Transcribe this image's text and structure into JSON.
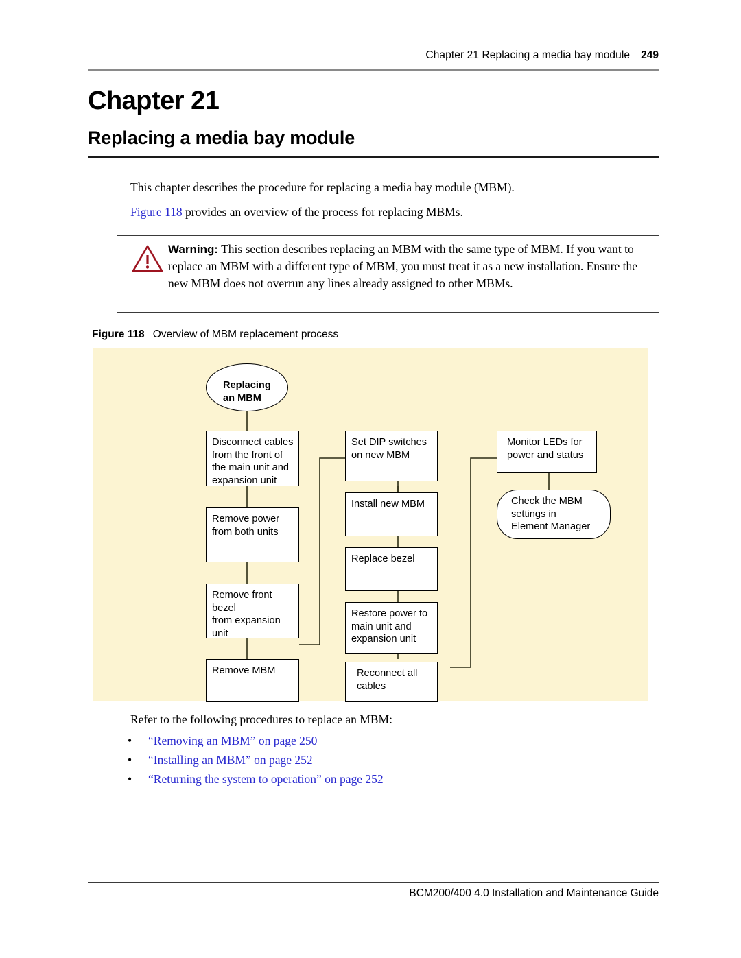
{
  "header": {
    "title": "Chapter 21  Replacing a media bay module",
    "page_number": "249"
  },
  "chapter": {
    "number_label": "Chapter 21",
    "title": "Replacing a media bay module"
  },
  "intro": {
    "paragraph_1": "This chapter describes the procedure for replacing a media bay module (MBM).",
    "xref_label": "Figure 118",
    "paragraph_2_rest": " provides an overview of the process for replacing MBMs."
  },
  "warning": {
    "icon_name": "warning-triangle-icon",
    "label": "Warning:",
    "text": " This section describes replacing an MBM with the same type of MBM. If you want to replace an MBM with a different type of MBM, you must treat it as a new installation. Ensure the new MBM does not overrun any lines already assigned to other MBMs.",
    "accent_color": "#9e1420"
  },
  "figure": {
    "label": "Figure 118",
    "caption": "Overview of MBM replacement process",
    "background_color": "#fcf4d2",
    "nodes": {
      "start": "Replacing\nan MBM",
      "col1_1": "Disconnect cables\nfrom the front of\nthe main unit and\nexpansion unit",
      "col1_2": "Remove power\nfrom both units",
      "col1_3": "Remove front bezel\nfrom expansion unit",
      "col1_4": "Remove MBM",
      "col2_1": "Set DIP switches\non new MBM",
      "col2_2": "Install new MBM",
      "col2_3": "Replace bezel",
      "col2_4": "Restore power to\nmain unit and\nexpansion unit",
      "col2_5": "Reconnect all\ncables",
      "col3_1": "Monitor LEDs for\npower and status",
      "col3_2": "Check the MBM\nsettings in\nElement Manager"
    }
  },
  "tail": {
    "lead_in": "Refer to the following procedures to replace an MBM:",
    "bullet_char": "•",
    "links": [
      "“Removing an MBM” on page 250",
      "“Installing an MBM” on page 252",
      "“Returning the system to operation” on page 252"
    ],
    "link_color": "#2a2ad0"
  },
  "footer": {
    "text": "BCM200/400 4.0 Installation and Maintenance Guide"
  }
}
